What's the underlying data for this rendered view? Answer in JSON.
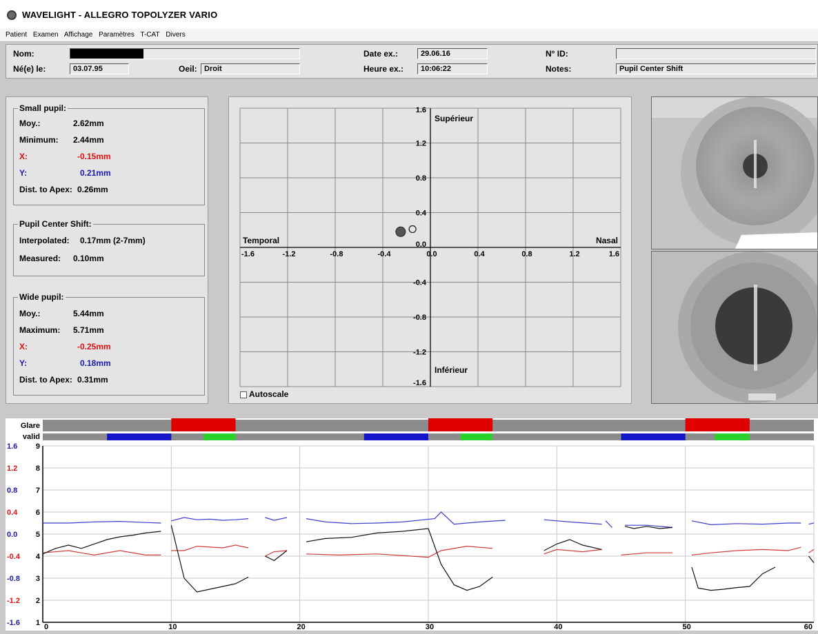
{
  "window": {
    "title": "WAVELIGHT  -  ALLEGRO TOPOLYZER VARIO"
  },
  "menu": [
    "Patient",
    "Examen",
    "Affichage",
    "Paramètres",
    "T-CAT",
    "Divers"
  ],
  "header": {
    "nom_label": "Nom:",
    "nom_value": "",
    "nele_label": "Né(e) le:",
    "nele_value": "03.07.95",
    "oeil_label": "Oeil:",
    "oeil_value": "Droit",
    "dateex_label": "Date ex.:",
    "dateex_value": "29.06.16",
    "heureex_label": "Heure ex.:",
    "heureex_value": "10:06:22",
    "id_label": "N° ID:",
    "id_value": "",
    "notes_label": "Notes:",
    "notes_value": "Pupil Center Shift"
  },
  "small_pupil": {
    "title": "Small pupil:",
    "moy_label": "Moy.:",
    "moy_value": "2.62mm",
    "min_label": "Minimum:",
    "min_value": "2.44mm",
    "x_label": "X:",
    "x_value": "-0.15mm",
    "y_label": "Y:",
    "y_value": "0.21mm",
    "dist_label": "Dist. to Apex:",
    "dist_value": "0.26mm"
  },
  "pupil_center_shift": {
    "title": "Pupil Center Shift:",
    "interp_label": "Interpolated:",
    "interp_value": "0.17mm (2-7mm)",
    "meas_label": "Measured:",
    "meas_value": "0.10mm"
  },
  "wide_pupil": {
    "title": "Wide pupil:",
    "moy_label": "Moy.:",
    "moy_value": "5.44mm",
    "max_label": "Maximum:",
    "max_value": "5.71mm",
    "x_label": "X:",
    "x_value": "-0.25mm",
    "y_label": "Y:",
    "y_value": "0.18mm",
    "dist_label": "Dist. to Apex:",
    "dist_value": "0.31mm"
  },
  "autoscale_label": "Autoscale",
  "colors": {
    "red": "#e01010",
    "blue": "#1a1aa8",
    "green": "#2ad12a",
    "glare_red": "#e00000",
    "bar_gray": "#8c8c8c",
    "line_blue": "#3c3ccc",
    "line_red": "#d03a3a",
    "line_black": "#111111"
  },
  "chart_data": [
    {
      "type": "scatter",
      "xlim": [
        -1.6,
        1.6
      ],
      "ylim": [
        -1.6,
        1.6
      ],
      "x_ticks": [
        "-1.6",
        "-1.2",
        "-0.8",
        "-0.4",
        "0.0",
        "0.4",
        "0.8",
        "1.2",
        "1.6"
      ],
      "y_ticks": [
        "1.6",
        "1.2",
        "0.8",
        "0.4",
        "0.0",
        "-0.4",
        "-0.8",
        "-1.2",
        "-1.6"
      ],
      "annotations": {
        "top": "Supérieur",
        "bottom": "Inférieur",
        "left": "Temporal",
        "right": "Nasal"
      },
      "points": [
        {
          "x": -0.25,
          "y": 0.18,
          "marker": "filled"
        },
        {
          "x": -0.15,
          "y": 0.21,
          "marker": "open"
        }
      ],
      "grid": true
    },
    {
      "type": "line",
      "xlim": [
        0,
        60
      ],
      "x_ticks": [
        0,
        10,
        20,
        30,
        40,
        50,
        60
      ],
      "y_left_ticks": [
        "1.6",
        "1.2",
        "0.8",
        "0.4",
        "0.0",
        "-0.4",
        "-0.8",
        "-1.2",
        "-1.6"
      ],
      "y_left_colors": [
        "blue",
        "red",
        "blue",
        "red",
        "blue",
        "red",
        "blue",
        "red",
        "blue"
      ],
      "y_right_ticks": [
        9,
        8,
        7,
        6,
        5,
        4,
        3,
        2,
        1
      ],
      "row_labels": {
        "glare": "Glare",
        "valid": "valid"
      },
      "glare_segments": [
        [
          10,
          15
        ],
        [
          30,
          35
        ],
        [
          50,
          55
        ]
      ],
      "blue_segments": [
        [
          5,
          10
        ],
        [
          25,
          30
        ],
        [
          45,
          50
        ]
      ],
      "green_segments": [
        [
          12.5,
          15
        ],
        [
          32.5,
          35
        ],
        [
          52.3,
          55
        ]
      ],
      "series": [
        {
          "color": "blue",
          "segments": [
            [
              [
                0,
                0.2
              ],
              [
                2,
                0.2
              ],
              [
                4,
                0.22
              ],
              [
                6,
                0.23
              ],
              [
                8,
                0.21
              ],
              [
                9.2,
                0.2
              ]
            ],
            [
              [
                10,
                0.24
              ],
              [
                11,
                0.3
              ],
              [
                12,
                0.26
              ],
              [
                13,
                0.27
              ],
              [
                14,
                0.25
              ],
              [
                15,
                0.26
              ],
              [
                16,
                0.28
              ]
            ],
            [
              [
                17.3,
                0.3
              ],
              [
                18,
                0.25
              ],
              [
                19,
                0.3
              ]
            ],
            [
              [
                20.5,
                0.28
              ],
              [
                22,
                0.22
              ],
              [
                24,
                0.19
              ],
              [
                26,
                0.2
              ],
              [
                28,
                0.22
              ],
              [
                30.5,
                0.28
              ],
              [
                31,
                0.4
              ],
              [
                32,
                0.18
              ],
              [
                34,
                0.22
              ],
              [
                36,
                0.25
              ]
            ],
            [
              [
                39,
                0.26
              ],
              [
                41,
                0.22
              ],
              [
                43.5,
                0.18
              ]
            ],
            [
              [
                43.8,
                0.24
              ],
              [
                44.3,
                0.12
              ]
            ],
            [
              [
                45.3,
                0.16
              ],
              [
                47,
                0.16
              ],
              [
                49,
                0.12
              ]
            ],
            [
              [
                50.5,
                0.24
              ],
              [
                52,
                0.17
              ],
              [
                54,
                0.19
              ],
              [
                56,
                0.18
              ],
              [
                58,
                0.2
              ],
              [
                59,
                0.2
              ]
            ],
            [
              [
                59.6,
                0.18
              ],
              [
                60,
                0.2
              ]
            ]
          ]
        },
        {
          "color": "red",
          "segments": [
            [
              [
                0,
                -0.34
              ],
              [
                2,
                -0.3
              ],
              [
                4,
                -0.38
              ],
              [
                6,
                -0.3
              ],
              [
                8,
                -0.38
              ],
              [
                9.2,
                -0.38
              ]
            ],
            [
              [
                10,
                -0.3
              ],
              [
                11,
                -0.3
              ],
              [
                12,
                -0.22
              ],
              [
                14,
                -0.25
              ],
              [
                15,
                -0.2
              ],
              [
                16,
                -0.25
              ]
            ],
            [
              [
                17.3,
                -0.4
              ],
              [
                18,
                -0.32
              ],
              [
                19,
                -0.3
              ]
            ],
            [
              [
                20.5,
                -0.36
              ],
              [
                23,
                -0.38
              ],
              [
                26,
                -0.36
              ],
              [
                30,
                -0.42
              ],
              [
                31,
                -0.3
              ],
              [
                33,
                -0.22
              ],
              [
                35,
                -0.26
              ]
            ],
            [
              [
                39,
                -0.36
              ],
              [
                40,
                -0.28
              ],
              [
                42,
                -0.32
              ],
              [
                43.5,
                -0.28
              ]
            ],
            [
              [
                45,
                -0.38
              ],
              [
                47,
                -0.34
              ],
              [
                49,
                -0.34
              ]
            ],
            [
              [
                50.5,
                -0.38
              ],
              [
                52,
                -0.34
              ],
              [
                54,
                -0.3
              ],
              [
                56,
                -0.28
              ],
              [
                58,
                -0.3
              ],
              [
                59,
                -0.24
              ]
            ],
            [
              [
                59.6,
                -0.34
              ],
              [
                60,
                -0.28
              ]
            ]
          ]
        },
        {
          "color": "black",
          "segments": [
            [
              [
                0,
                -0.36
              ],
              [
                1,
                -0.26
              ],
              [
                2,
                -0.2
              ],
              [
                3,
                -0.26
              ],
              [
                4,
                -0.18
              ],
              [
                5,
                -0.1
              ],
              [
                6,
                -0.05
              ],
              [
                7,
                -0.02
              ],
              [
                8,
                0.02
              ],
              [
                9.2,
                0.05
              ]
            ],
            [
              [
                10,
                0.16
              ],
              [
                11,
                -0.8
              ],
              [
                12,
                -1.05
              ],
              [
                13,
                -1.0
              ],
              [
                14,
                -0.95
              ],
              [
                15,
                -0.9
              ],
              [
                16,
                -0.78
              ]
            ],
            [
              [
                17.3,
                -0.4
              ],
              [
                18,
                -0.48
              ],
              [
                19,
                -0.3
              ]
            ],
            [
              [
                20.5,
                -0.14
              ],
              [
                22,
                -0.08
              ],
              [
                24,
                -0.06
              ],
              [
                26,
                0.02
              ],
              [
                28,
                0.05
              ],
              [
                30,
                0.1
              ],
              [
                31,
                -0.55
              ],
              [
                32,
                -0.92
              ],
              [
                33,
                -1.02
              ],
              [
                34,
                -0.95
              ],
              [
                35,
                -0.78
              ]
            ],
            [
              [
                39,
                -0.3
              ],
              [
                40,
                -0.18
              ],
              [
                41,
                -0.1
              ],
              [
                42,
                -0.2
              ],
              [
                43.5,
                -0.28
              ]
            ],
            [
              [
                45.3,
                0.14
              ],
              [
                46,
                0.1
              ],
              [
                47,
                0.14
              ],
              [
                48,
                0.1
              ],
              [
                49,
                0.12
              ]
            ],
            [
              [
                50.5,
                -0.6
              ],
              [
                51,
                -0.98
              ],
              [
                52,
                -1.02
              ],
              [
                53,
                -1.0
              ],
              [
                54,
                -0.97
              ],
              [
                55,
                -0.95
              ],
              [
                56,
                -0.72
              ],
              [
                57,
                -0.6
              ]
            ],
            [
              [
                59.6,
                -0.4
              ],
              [
                60,
                -0.52
              ]
            ]
          ]
        }
      ]
    }
  ]
}
